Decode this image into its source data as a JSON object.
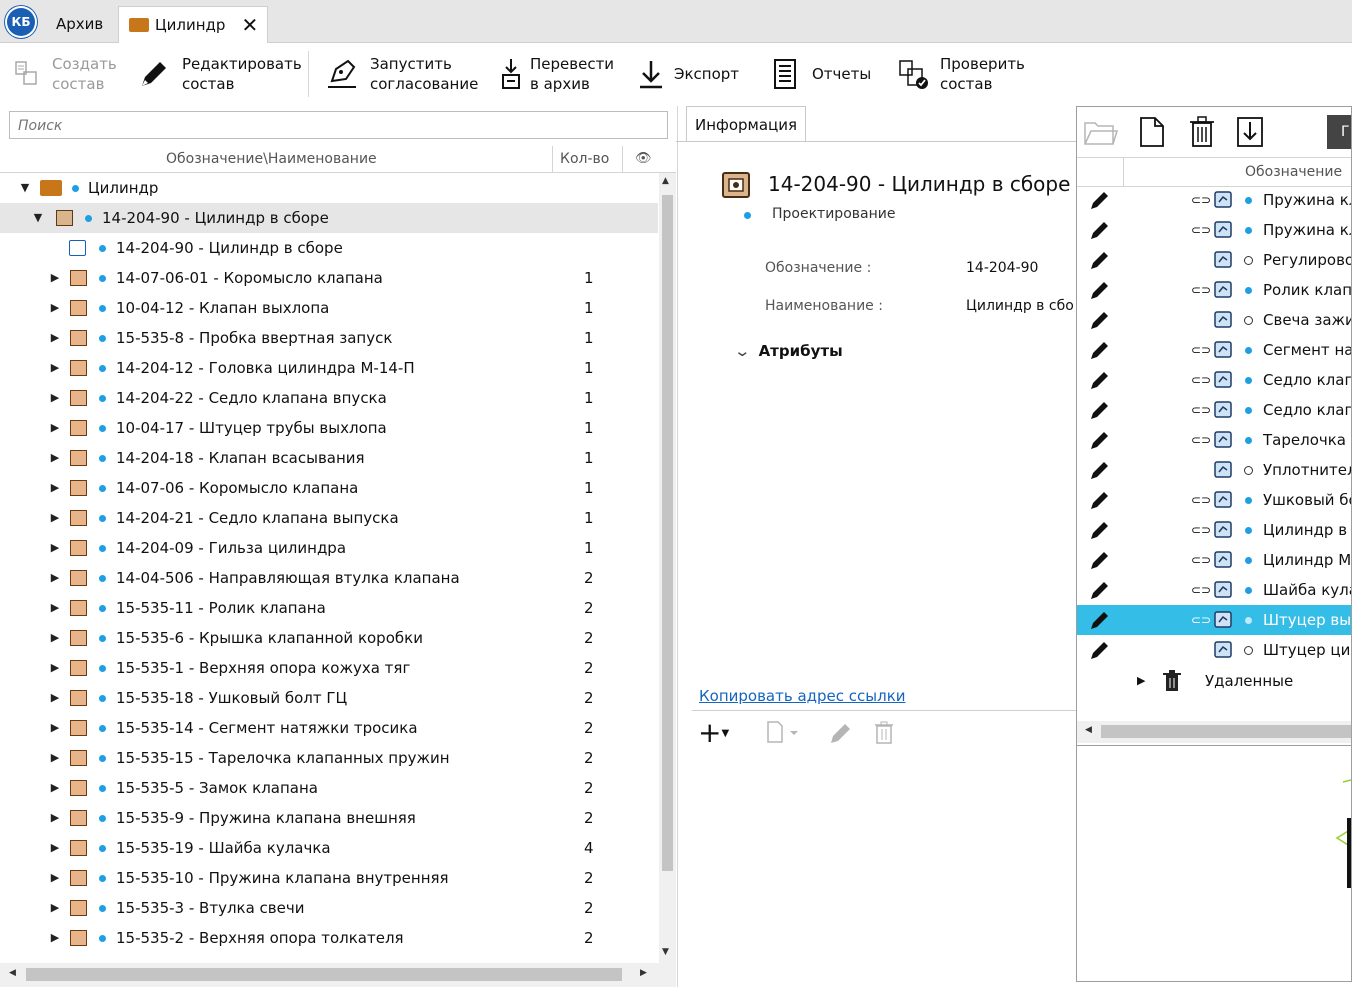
{
  "tabs": [
    {
      "label": "Архив"
    },
    {
      "label": "Цилиндр"
    }
  ],
  "logo_text": "КБ",
  "toolbar": {
    "create": "Создать\nсостав",
    "edit": "Редактировать\nсостав",
    "approve": "Запустить\nсогласование",
    "archive": "Перевести\nв архив",
    "export": "Экспорт",
    "reports": "Отчеты",
    "check": "Проверить\nсостав"
  },
  "search": {
    "placeholder": "Поиск"
  },
  "tree_header": {
    "designation": "Обозначение\\Наименование",
    "qty": "Кол-во"
  },
  "tree": {
    "root": "Цилиндр",
    "assembly": "14-204-90 - Цилиндр в сборе",
    "assembly_doc": "14-204-90 - Цилиндр в сборе",
    "items": [
      {
        "name": "14-07-06-01 - Коромысло клапана",
        "qty": "1"
      },
      {
        "name": "10-04-12 - Клапан выхлопа",
        "qty": "1"
      },
      {
        "name": "15-535-8 - Пробка ввертная запуск",
        "qty": "1"
      },
      {
        "name": "14-204-12 - Головка цилиндра М-14-П",
        "qty": "1"
      },
      {
        "name": "14-204-22 - Седло клапана впуска",
        "qty": "1"
      },
      {
        "name": "10-04-17 - Штуцер трубы выхлопа",
        "qty": "1"
      },
      {
        "name": "14-204-18 - Клапан всасывания",
        "qty": "1"
      },
      {
        "name": "14-07-06 - Коромысло клапана",
        "qty": "1"
      },
      {
        "name": "14-204-21 - Седло клапана выпуска",
        "qty": "1"
      },
      {
        "name": "14-204-09 - Гильза цилиндра",
        "qty": "1"
      },
      {
        "name": "14-04-506 - Направляющая втулка клапана",
        "qty": "2"
      },
      {
        "name": "15-535-11 - Ролик клапана",
        "qty": "2"
      },
      {
        "name": "15-535-6 - Крышка клапанной коробки",
        "qty": "2"
      },
      {
        "name": "15-535-1 - Верхняя опора кожуха тяг",
        "qty": "2"
      },
      {
        "name": "15-535-18 - Ушковый болт ГЦ",
        "qty": "2"
      },
      {
        "name": "15-535-14 - Сегмент натяжки тросика",
        "qty": "2"
      },
      {
        "name": "15-535-15 - Тарелочка клапанных пружин",
        "qty": "2"
      },
      {
        "name": "15-535-5 - Замок клапана",
        "qty": "2"
      },
      {
        "name": "15-535-9 - Пружина клапана внешняя",
        "qty": "2"
      },
      {
        "name": "15-535-19 - Шайба кулачка",
        "qty": "4"
      },
      {
        "name": "15-535-10 - Пружина клапана внутренняя",
        "qty": "2"
      },
      {
        "name": "15-535-3 - Втулка свечи",
        "qty": "2"
      },
      {
        "name": "15-535-2 - Верхняя опора толкателя",
        "qty": "2"
      }
    ]
  },
  "info": {
    "tab": "Информация",
    "title": "14-204-90 - Цилиндр в сборе",
    "state": "Проектирование",
    "designation_label": "Обозначение :",
    "designation_value": "14-204-90",
    "name_label": "Наименование :",
    "name_value": "Цилиндр в сбо",
    "attributes": "Атрибуты",
    "copy_link": "Копировать адрес ссылки"
  },
  "right": {
    "header": "Обозначение",
    "rows": [
      {
        "text": "Пружина кл",
        "link": true,
        "dot": "filled"
      },
      {
        "text": "Пружина кл",
        "link": true,
        "dot": "filled"
      },
      {
        "text": "Регулирово",
        "link": false,
        "dot": "hollow"
      },
      {
        "text": "Ролик клапа",
        "link": true,
        "dot": "filled"
      },
      {
        "text": "Свеча зажи",
        "link": false,
        "dot": "hollow"
      },
      {
        "text": "Сегмент нат",
        "link": true,
        "dot": "filled"
      },
      {
        "text": "Седло клапа",
        "link": true,
        "dot": "filled"
      },
      {
        "text": "Седло клапа",
        "link": true,
        "dot": "filled"
      },
      {
        "text": "Тарелочка к",
        "link": true,
        "dot": "filled"
      },
      {
        "text": "Уплотнител",
        "link": false,
        "dot": "hollow"
      },
      {
        "text": "Ушковый бо",
        "link": true,
        "dot": "filled"
      },
      {
        "text": "Цилиндр в с",
        "link": true,
        "dot": "filled"
      },
      {
        "text": "Цилиндр М",
        "link": true,
        "dot": "filled"
      },
      {
        "text": "Шайба кула",
        "link": true,
        "dot": "filled"
      },
      {
        "text": "Штуцер вых",
        "link": true,
        "dot": "filled"
      },
      {
        "text": "Штуцер цил",
        "link": false,
        "dot": "hollow"
      }
    ],
    "selected_index": 14,
    "deleted": "Удаленные"
  },
  "colors": {
    "accent": "#1e9fe3",
    "selection": "#34bde6",
    "link": "#1565c0"
  }
}
